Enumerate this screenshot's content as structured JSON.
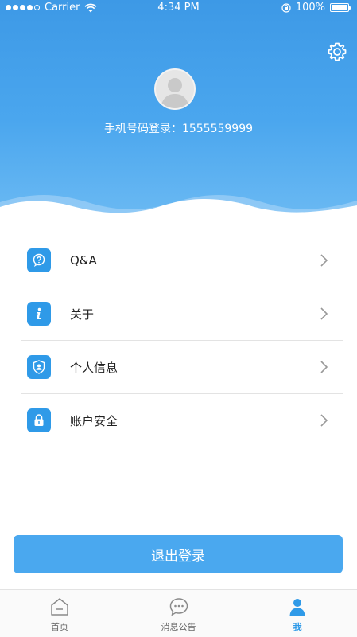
{
  "status_bar": {
    "carrier": "Carrier",
    "time": "4:34 PM",
    "battery": "100%"
  },
  "profile": {
    "login_text": "手机号码登录：1555559999"
  },
  "menu": {
    "items": [
      {
        "label": "Q&A",
        "icon": "question-icon"
      },
      {
        "label": "关于",
        "icon": "info-icon"
      },
      {
        "label": "个人信息",
        "icon": "profile-shield-icon"
      },
      {
        "label": "账户安全",
        "icon": "lock-icon"
      }
    ]
  },
  "logout": {
    "label": "退出登录"
  },
  "tab_bar": {
    "tabs": [
      {
        "label": "首页",
        "icon": "home-icon",
        "active": false
      },
      {
        "label": "消息公告",
        "icon": "message-icon",
        "active": false
      },
      {
        "label": "我",
        "icon": "user-icon",
        "active": true
      }
    ]
  },
  "colors": {
    "accent": "#2f9ae8",
    "header_blue": "#3d99e6",
    "button_blue": "#4aa8ef"
  }
}
